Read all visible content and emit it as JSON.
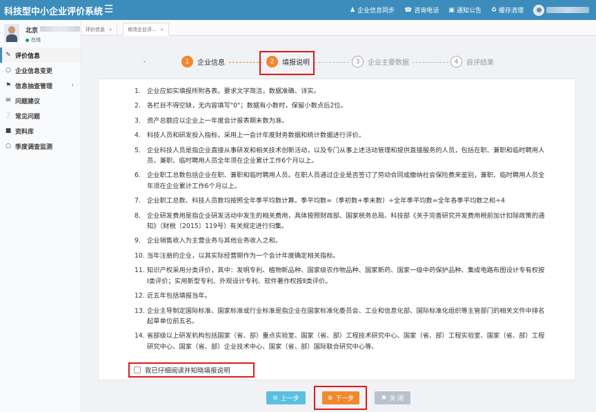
{
  "header": {
    "title": "科技型中小企业评价系统",
    "nav": [
      {
        "icon": "user-icon",
        "label": "企业信息同步"
      },
      {
        "icon": "phone-icon",
        "label": "咨询电话"
      },
      {
        "icon": "notice-icon",
        "label": "通知公告"
      },
      {
        "icon": "recycle-icon",
        "label": "缓存清理"
      }
    ]
  },
  "user": {
    "name": "北京",
    "status": "在线"
  },
  "sidebar": {
    "items": [
      {
        "label": "评价信息",
        "active": true
      },
      {
        "label": "企业信息变更"
      },
      {
        "label": "信息抽查管理",
        "arrow": "‹"
      },
      {
        "label": "问题建议"
      },
      {
        "label": "常见问题"
      },
      {
        "label": "资料库"
      },
      {
        "label": "季度调查监测"
      }
    ]
  },
  "tabs": [
    {
      "label": "评价信息",
      "close": "×"
    },
    {
      "label": "修改企业评...",
      "close": "×"
    }
  ],
  "steps": [
    {
      "num": "1",
      "label": "企业信息",
      "state": "done"
    },
    {
      "num": "2",
      "label": "填报说明",
      "state": "current"
    },
    {
      "num": "3",
      "label": "企业主要数据",
      "state": "todo"
    },
    {
      "num": "4",
      "label": "自评结果",
      "state": "todo"
    }
  ],
  "instructions": [
    {
      "num": "1.",
      "text": "企业应如实填报所附各表。要求文字简洁，数据准确、详实。"
    },
    {
      "num": "2.",
      "text": "各栏目不得空缺，无内容填写\"0\"；数据有小数时，保留小数点后2位。"
    },
    {
      "num": "3.",
      "text": "资产总额应以企业上一年度会计报表期末数为准。"
    },
    {
      "num": "4.",
      "text": "科技人员和研发投入指标，采用上一会计年度财务数据和统计数据进行评价。"
    },
    {
      "num": "5.",
      "text": "企业科技人员是指企业直接从事研发和相关技术创新活动，以及专门从事上述活动管理和提供直接服务的人员，包括在职、兼职和临时聘用人员，兼职、临时聘用人员全年须在企业累计工作6个月以上。"
    },
    {
      "num": "6.",
      "text": "企业职工总数包括企业在职、兼职和临时聘用人员。在职人员通过企业是否签订了劳动合同或缴纳社会保险费来鉴别，兼职、临时聘用人员全年须在企业累计工作6个月以上。"
    },
    {
      "num": "7.",
      "text": "企业职工总数、科技人员数均按照全年季平均数计算。季平均数=（季初数+季末数）÷全年季平均数=全年各季平均数之和÷4"
    },
    {
      "num": "8.",
      "text": "企业研发费用是指企业研发活动中发生的相关费用，具体按照财政部、国家税务总局、科技部《关于完善研究开发费用税前加计扣除政策的通知》（财税〔2015〕119号）有关规定进行归集。"
    },
    {
      "num": "9.",
      "text": "企业销售收入为主营业务与其他业务收入之和。"
    },
    {
      "num": "10.",
      "text": "当年注册的企业，以其实际经营期作为一个会计年度确定相关指标。"
    },
    {
      "num": "11.",
      "text": "知识产权采用分类评价，其中：发明专利、植物新品种、国家级农作物品种、国家新药、国家一级中药保护品种、集成电路布图设计专有权按Ⅰ类评价；实用新型专利、外观设计专利、软件著作权按Ⅱ类评价。"
    },
    {
      "num": "12.",
      "text": "近五年包括填报当年。"
    },
    {
      "num": "13.",
      "text": "企业主导制定国际标准、国家标准或行业标准是指企业在国家标准化委员会、工业和信息化部、国际标准化组织等主管部门的相关文件中排名起草单位前五名。"
    },
    {
      "num": "14.",
      "text": "省部级以上研发机构包括国家（省、部）重点实验室、国家（省、部）工程技术研究中心、国家（省、部）工程实验室、国家（省、部）工程研究中心、国家（省、部）企业技术中心、国家（省、部）国际联合研究中心等。"
    }
  ],
  "agree": {
    "label": "我已仔细阅读并知晓填报说明",
    "checked": false
  },
  "buttons": {
    "prev": "上一步",
    "next": "下一步",
    "close": "关 闭"
  },
  "colors": {
    "header": "#3c8dbc",
    "accent": "#f0882e",
    "prev": "#5bc0de",
    "close": "#b9c2cc",
    "highlight": "#e01616"
  }
}
